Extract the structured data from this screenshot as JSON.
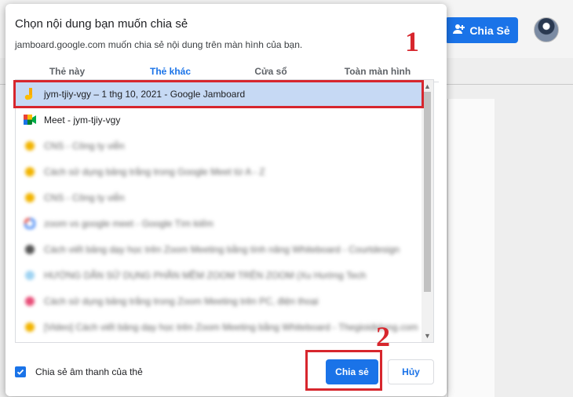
{
  "background": {
    "share_button_label": "Chia Sẻ"
  },
  "dialog": {
    "title": "Chọn nội dung bạn muốn chia sẻ",
    "subtitle": "jamboard.google.com muốn chia sẻ nội dung trên màn hình của bạn.",
    "tabs": [
      {
        "label": "Thẻ này",
        "active": false
      },
      {
        "label": "Thẻ khác",
        "active": true
      },
      {
        "label": "Cửa sổ",
        "active": false
      },
      {
        "label": "Toàn màn hình",
        "active": false
      }
    ],
    "items": [
      {
        "label": "jym-tjiy-vgy – 1 thg 10, 2021 - Google Jamboard",
        "icon": "jamboard-icon",
        "selected": true
      },
      {
        "label": "Meet - jym-tjiy-vgy",
        "icon": "meet-icon",
        "selected": false
      },
      {
        "label": "CNS - Công ty viễn",
        "icon": "page-icon",
        "blurred": true
      },
      {
        "label": "Cách sử dụng bảng trắng trong Google Meet từ A - Z",
        "icon": "page-icon",
        "blurred": true
      },
      {
        "label": "CNS - Công ty viễn",
        "icon": "page-icon",
        "blurred": true
      },
      {
        "label": "zoom vs google meet - Google Tìm kiếm",
        "icon": "google-icon",
        "blurred": true
      },
      {
        "label": "Cách viết bảng dạy học trên Zoom Meeting bằng tính năng Whiteboard - Courtdesign",
        "icon": "page-icon",
        "blurred": true
      },
      {
        "label": "HƯỚNG DẪN SỬ DỤNG PHẦN MỀM ZOOM TRÊN ZOOM (Xu Hướng Tech",
        "icon": "page-icon",
        "blurred": true
      },
      {
        "label": "Cách sử dụng bảng trắng trong Zoom Meeting trên PC, điện thoại",
        "icon": "heart-icon",
        "blurred": true
      },
      {
        "label": "[Video] Cách viết bảng dạy học trên Zoom Meeting bằng Whiteboard - Thegioididong.com",
        "icon": "page-icon",
        "blurred": true
      }
    ],
    "audio_label": "Chia sẻ âm thanh của thẻ",
    "share_label": "Chia sẻ",
    "cancel_label": "Hủy"
  },
  "annotations": {
    "step1": "1",
    "step2": "2"
  },
  "colors": {
    "accent": "#1a73e8",
    "selected_row": "#c6d9f4",
    "annotation_red": "#d7262d"
  }
}
